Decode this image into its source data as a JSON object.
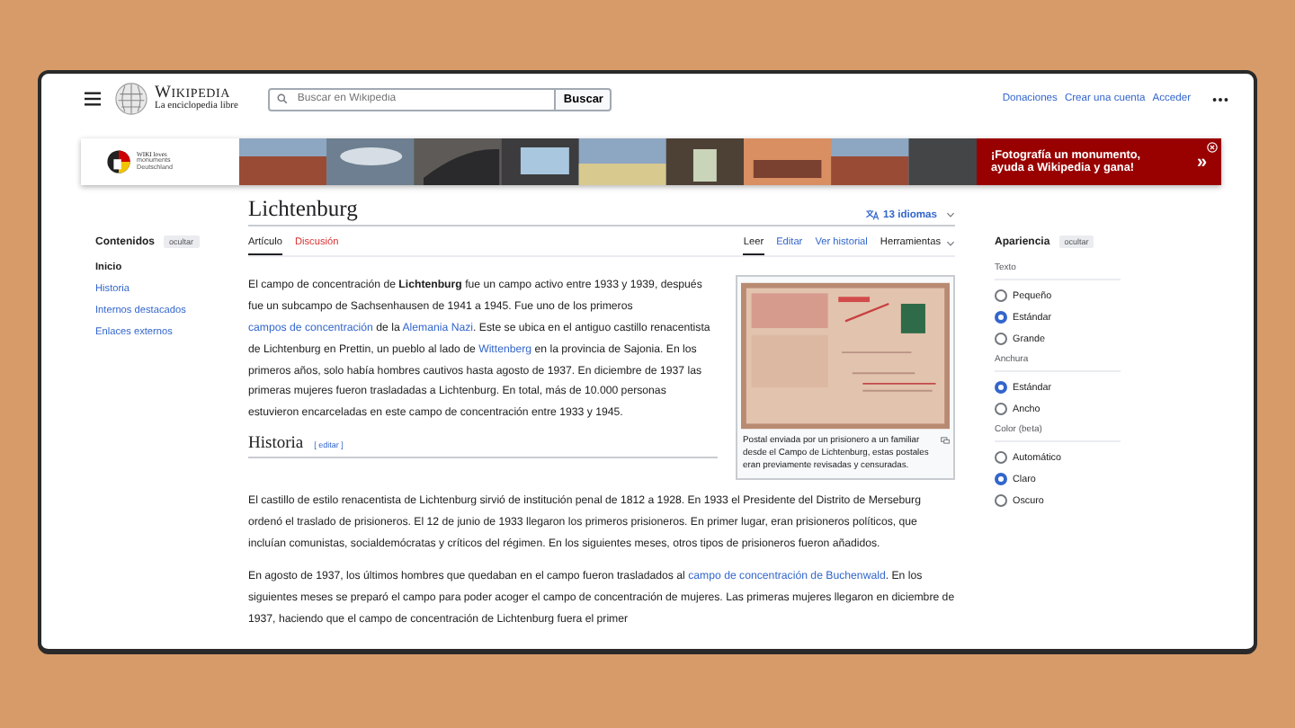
{
  "header": {
    "logo_title": "Wikipedia",
    "logo_subtitle": "La enciclopedia libre",
    "search": {
      "placeholder": "Buscar en Wikipedia",
      "button": "Buscar"
    },
    "links": [
      "Donaciones",
      "Crear una cuenta",
      "Acceder"
    ]
  },
  "banner": {
    "logo_lines": [
      "WIKI loves",
      "monuments",
      "Deutschland"
    ],
    "message": [
      "¡Fotografía un monumento,",
      "ayuda a Wikipedia y gana!"
    ],
    "arrow": "»"
  },
  "toc": {
    "title": "Contenidos",
    "hide": "ocultar",
    "items": [
      {
        "label": "Inicio",
        "selected": true
      },
      {
        "label": "Historia",
        "selected": false
      },
      {
        "label": "Internos destacados",
        "selected": false
      },
      {
        "label": "Enlaces externos",
        "selected": false
      }
    ]
  },
  "article": {
    "title": "Lichtenburg",
    "languages": "13 idiomas",
    "tabs": [
      {
        "label": "Artículo",
        "selected": true,
        "missing": false
      },
      {
        "label": "Discusión",
        "selected": false,
        "missing": true
      }
    ],
    "views": [
      {
        "label": "Leer",
        "selected": true,
        "kind": "tab"
      },
      {
        "label": "Editar",
        "selected": false,
        "kind": "tab"
      },
      {
        "label": "Ver historial",
        "selected": false,
        "kind": "tab"
      },
      {
        "label": "Herramientas",
        "selected": false,
        "kind": "menu"
      }
    ],
    "intro": [
      {
        "kind": "text",
        "text": "El campo de concentración de "
      },
      {
        "kind": "bold",
        "text": "Lichtenburg"
      },
      {
        "kind": "text",
        "text": " fue un campo activo entre 1933 y 1939, después fue un subcampo de Sachsenhausen de 1941 a 1945. Fue uno de los primeros "
      },
      {
        "kind": "link",
        "text": "campos de concentración"
      },
      {
        "kind": "text",
        "text": " de la "
      },
      {
        "kind": "link",
        "text": "Alemania Nazi"
      },
      {
        "kind": "text",
        "text": ". Este se ubica en el antiguo castillo renacentista de Lichtenburg en Prettin, un pueblo al lado de "
      },
      {
        "kind": "link",
        "text": "Wittenberg"
      },
      {
        "kind": "text",
        "text": " en la provincia de Sajonia. En los primeros años, solo había hombres cautivos hasta agosto de 1937. En diciembre de 1937 las primeras mujeres fueron trasladadas a Lichtenburg. En total, más de 10.000 personas estuvieron encarceladas en este campo de concentración entre 1933 y 1945."
      }
    ],
    "figure": {
      "caption": "Postal enviada por un prisionero a un familiar desde el Campo de Lichtenburg, estas postales eran previamente revisadas y censuradas."
    },
    "section": {
      "heading": "Historia",
      "edit": "[ editar ]",
      "paragraphs": [
        [
          {
            "kind": "text",
            "text": "El castillo de estilo renacentista de Lichtenburg sirvió de institución penal de 1812 a 1928. En 1933 el Presidente del Distrito de Merseburg ordenó el traslado de prisioneros. El 12 de junio de 1933 llegaron los primeros prisioneros. En primer lugar, eran prisioneros políticos, que incluían comunistas, socialdemócratas y críticos del régimen. En los siguientes meses, otros tipos de prisioneros fueron añadidos."
          }
        ],
        [
          {
            "kind": "text",
            "text": "En agosto de 1937, los últimos hombres que quedaban en el campo fueron trasladados al "
          },
          {
            "kind": "link",
            "text": "campo de concentración de Buchenwald"
          },
          {
            "kind": "text",
            "text": ". En los siguientes meses se preparó el campo para poder acoger el campo de concentración de mujeres. Las primeras mujeres llegaron en diciembre de 1937, haciendo que el campo de concentración de Lichtenburg fuera el primer"
          }
        ]
      ]
    }
  },
  "appearance": {
    "title": "Apariencia",
    "hide": "ocultar",
    "groups": [
      {
        "label": "Texto",
        "options": [
          {
            "label": "Pequeño",
            "selected": false
          },
          {
            "label": "Estándar",
            "selected": true
          },
          {
            "label": "Grande",
            "selected": false
          }
        ]
      },
      {
        "label": "Anchura",
        "options": [
          {
            "label": "Estándar",
            "selected": true
          },
          {
            "label": "Ancho",
            "selected": false
          }
        ]
      },
      {
        "label": "Color (beta)",
        "options": [
          {
            "label": "Automático",
            "selected": false
          },
          {
            "label": "Claro",
            "selected": true
          },
          {
            "label": "Oscuro",
            "selected": false
          }
        ]
      }
    ]
  }
}
